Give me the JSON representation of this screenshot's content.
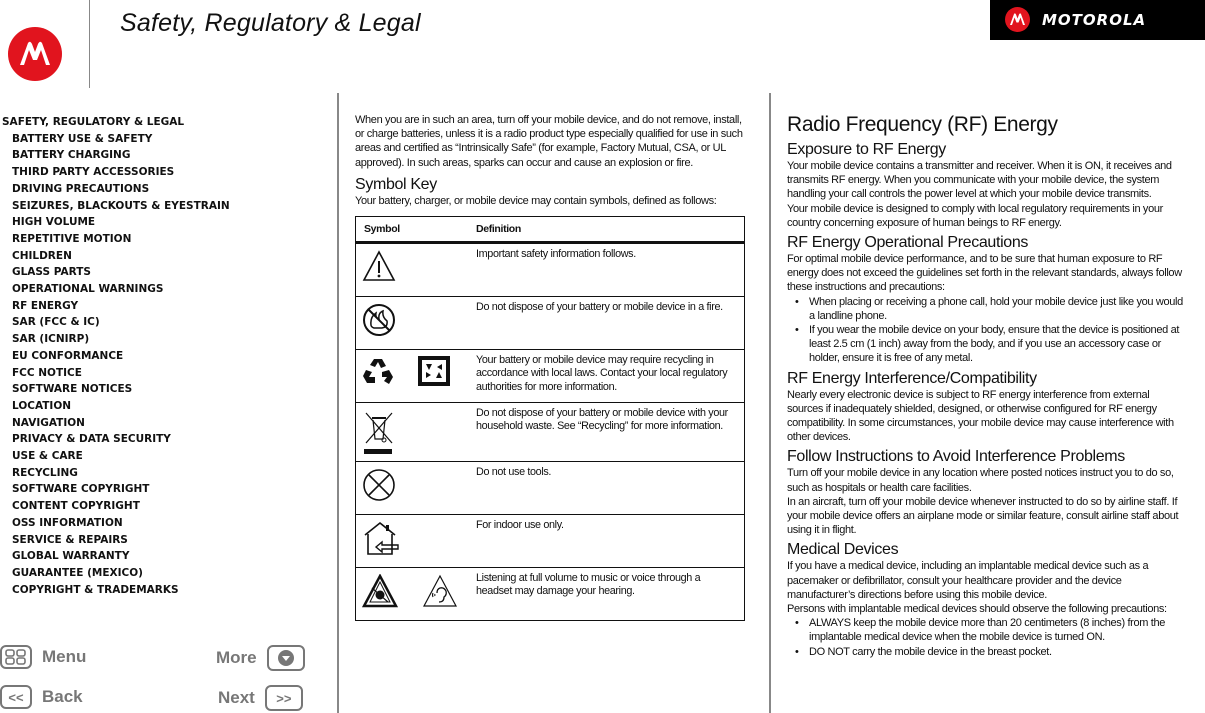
{
  "header": {
    "title": "Safety, Regulatory & Legal",
    "brand_name": "MOTOROLA",
    "brand_color": "#e1141e"
  },
  "toc": {
    "items": [
      {
        "label": "SAFETY, REGULATORY & LEGAL",
        "level": 0
      },
      {
        "label": "BATTERY USE & SAFETY",
        "level": 1
      },
      {
        "label": "BATTERY CHARGING",
        "level": 1
      },
      {
        "label": "THIRD PARTY ACCESSORIES",
        "level": 1
      },
      {
        "label": "DRIVING PRECAUTIONS",
        "level": 1
      },
      {
        "label": "SEIZURES, BLACKOUTS & EYESTRAIN",
        "level": 1
      },
      {
        "label": "HIGH VOLUME",
        "level": 1
      },
      {
        "label": "REPETITIVE MOTION",
        "level": 1
      },
      {
        "label": "CHILDREN",
        "level": 1
      },
      {
        "label": "GLASS PARTS",
        "level": 1
      },
      {
        "label": "OPERATIONAL WARNINGS",
        "level": 1
      },
      {
        "label": "RF ENERGY",
        "level": 1
      },
      {
        "label": "SAR (FCC & IC)",
        "level": 1
      },
      {
        "label": "SAR (ICNIRP)",
        "level": 1
      },
      {
        "label": "EU CONFORMANCE",
        "level": 1
      },
      {
        "label": "FCC NOTICE",
        "level": 1
      },
      {
        "label": "SOFTWARE NOTICES",
        "level": 1
      },
      {
        "label": "LOCATION",
        "level": 1
      },
      {
        "label": "NAVIGATION",
        "level": 1
      },
      {
        "label": "PRIVACY & DATA SECURITY",
        "level": 1
      },
      {
        "label": "USE & CARE",
        "level": 1
      },
      {
        "label": "RECYCLING",
        "level": 1
      },
      {
        "label": "SOFTWARE COPYRIGHT",
        "level": 1
      },
      {
        "label": "CONTENT COPYRIGHT",
        "level": 1
      },
      {
        "label": "OSS INFORMATION",
        "level": 1
      },
      {
        "label": "SERVICE & REPAIRS",
        "level": 1
      },
      {
        "label": "GLOBAL WARRANTY",
        "level": 1
      },
      {
        "label": "GUARANTEE (MEXICO)",
        "level": 1
      },
      {
        "label": "COPYRIGHT & TRADEMARKS",
        "level": 1
      }
    ]
  },
  "nav": {
    "menu": "Menu",
    "more": "More",
    "back": "Back",
    "next": "Next",
    "back_glyph": "<<",
    "next_glyph": ">>"
  },
  "col1": {
    "intro": "When you are in such an area, turn off your mobile device, and do not remove, install, or charge batteries, unless it is a radio product type especially qualified for use in such areas and certified as “Intrinsically Safe” (for example, Factory Mutual, CSA, or UL approved). In such areas, sparks can occur and cause an explosion or fire.",
    "symbol_key_heading": "Symbol Key",
    "symbol_key_intro": "Your battery, charger, or mobile device may contain symbols, defined as follows:",
    "table": {
      "headers": [
        "Symbol",
        "Definition"
      ],
      "rows": [
        {
          "icons": [
            "warning-triangle-icon"
          ],
          "definition": "Important safety information follows."
        },
        {
          "icons": [
            "no-fire-icon"
          ],
          "definition": "Do not dispose of your battery or mobile device in a fire."
        },
        {
          "icons": [
            "recycle-icon",
            "battery-recycle-icon"
          ],
          "definition": "Your battery or mobile device may require recycling in accordance with local laws. Contact your local regulatory authorities for more information."
        },
        {
          "icons": [
            "crossed-bin-icon"
          ],
          "definition": "Do not dispose of your battery or mobile device with your household waste. See “Recycling” for more information."
        },
        {
          "icons": [
            "no-tools-icon"
          ],
          "definition": "Do not use tools."
        },
        {
          "icons": [
            "indoor-use-icon"
          ],
          "definition": "For indoor use only."
        },
        {
          "icons": [
            "loud-volume-warning-icon",
            "hearing-warning-icon"
          ],
          "definition": "Listening at full volume to music or voice through a headset may damage your hearing."
        }
      ]
    }
  },
  "col2": {
    "title": "Radio Frequency (RF) Energy",
    "exposure_heading": "Exposure to RF Energy",
    "exposure_p1": "Your mobile device contains a transmitter and receiver. When it is ON, it receives and transmits RF energy. When you communicate with your mobile device, the system handling your call controls the power level at which your mobile device transmits.",
    "exposure_p2": "Your mobile device is designed to comply with local regulatory requirements in your country concerning exposure of human beings to RF energy.",
    "precautions_heading": "RF Energy Operational Precautions",
    "precautions_p": "For optimal mobile device performance, and to be sure that human exposure to RF energy does not exceed the guidelines set forth in the relevant standards, always follow these instructions and precautions:",
    "precautions_bullets": [
      "When placing or receiving a phone call, hold your mobile device just like you would a landline phone.",
      "If you wear the mobile device on your body, ensure that the device is positioned at least 2.5 cm (1 inch) away from the body, and if you use an accessory case or holder, ensure it is free of any metal."
    ],
    "interference_heading": "RF Energy Interference/Compatibility",
    "interference_p": "Nearly every electronic device is subject to RF energy interference from external sources if inadequately shielded, designed, or otherwise configured for RF energy compatibility. In some circumstances, your mobile device may cause interference with other devices.",
    "follow_heading": "Follow Instructions to Avoid Interference Problems",
    "follow_p1": "Turn off your mobile device in any location where posted notices instruct you to do so, such as hospitals or health care facilities.",
    "follow_p2": "In an aircraft, turn off your mobile device whenever instructed to do so by airline staff. If your mobile device offers an airplane mode or similar feature, consult airline staff about using it in flight.",
    "medical_heading": "Medical Devices",
    "medical_p1": "If you have a medical device, including an implantable medical device such as a pacemaker or defibrillator, consult your healthcare provider and the device manufacturer’s directions before using this mobile device.",
    "medical_p2": "Persons with implantable medical devices should observe the following precautions:",
    "medical_bullets": [
      "ALWAYS keep the mobile device more than 20 centimeters (8 inches) from the implantable medical device when the mobile device is turned ON.",
      "DO NOT carry the mobile device in the breast pocket."
    ]
  }
}
